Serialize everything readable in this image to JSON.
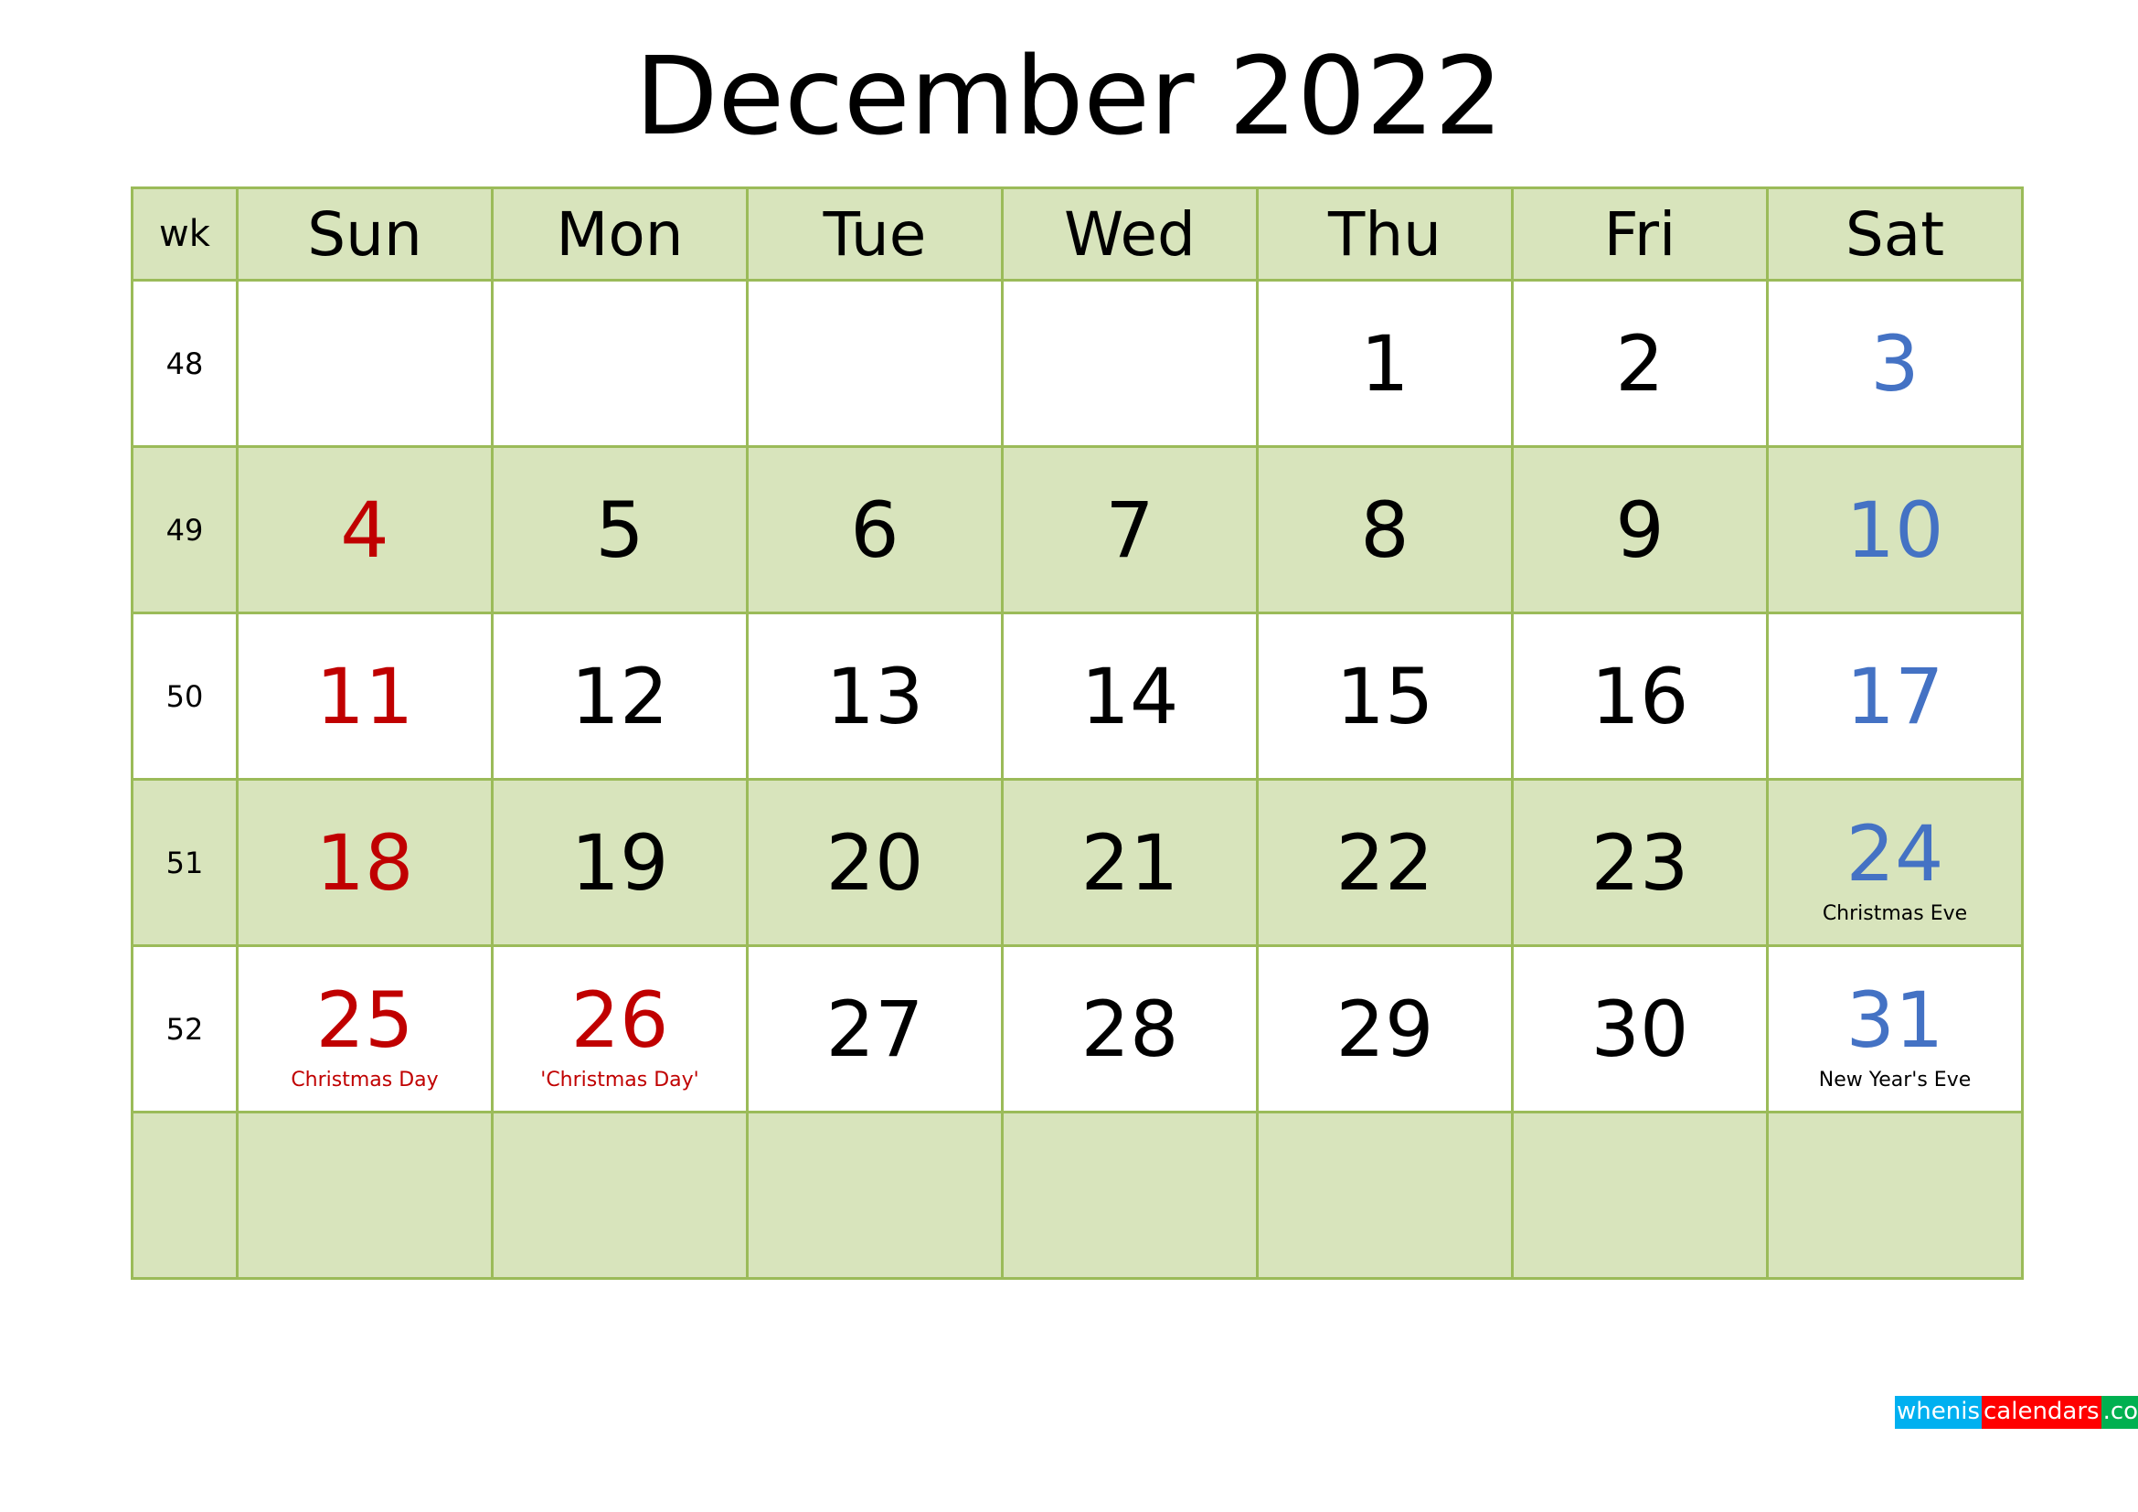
{
  "title": "December 2022",
  "header": {
    "wk": "wk",
    "days": [
      "Sun",
      "Mon",
      "Tue",
      "Wed",
      "Thu",
      "Fri",
      "Sat"
    ]
  },
  "colors": {
    "grid": "#9bbb59",
    "shade": "#d8e4bc",
    "sunday_holiday": "#c00000",
    "saturday": "#4472c4"
  },
  "weeks": [
    {
      "wk": "48",
      "cells": [
        {
          "d": ""
        },
        {
          "d": ""
        },
        {
          "d": ""
        },
        {
          "d": ""
        },
        {
          "d": "1"
        },
        {
          "d": "2"
        },
        {
          "d": "3"
        }
      ]
    },
    {
      "wk": "49",
      "cells": [
        {
          "d": "4"
        },
        {
          "d": "5"
        },
        {
          "d": "6"
        },
        {
          "d": "7"
        },
        {
          "d": "8"
        },
        {
          "d": "9"
        },
        {
          "d": "10"
        }
      ]
    },
    {
      "wk": "50",
      "cells": [
        {
          "d": "11"
        },
        {
          "d": "12"
        },
        {
          "d": "13"
        },
        {
          "d": "14"
        },
        {
          "d": "15"
        },
        {
          "d": "16"
        },
        {
          "d": "17"
        }
      ]
    },
    {
      "wk": "51",
      "cells": [
        {
          "d": "18"
        },
        {
          "d": "19"
        },
        {
          "d": "20"
        },
        {
          "d": "21"
        },
        {
          "d": "22"
        },
        {
          "d": "23"
        },
        {
          "d": "24",
          "note": "Christmas Eve"
        }
      ]
    },
    {
      "wk": "52",
      "cells": [
        {
          "d": "25",
          "note": "Christmas Day",
          "red": true
        },
        {
          "d": "26",
          "note": "'Christmas Day'",
          "red": true
        },
        {
          "d": "27"
        },
        {
          "d": "28"
        },
        {
          "d": "29"
        },
        {
          "d": "30"
        },
        {
          "d": "31",
          "note": "New Year's Eve"
        }
      ]
    },
    {
      "wk": "",
      "cells": [
        {
          "d": ""
        },
        {
          "d": ""
        },
        {
          "d": ""
        },
        {
          "d": ""
        },
        {
          "d": ""
        },
        {
          "d": ""
        },
        {
          "d": ""
        }
      ]
    }
  ],
  "logo": {
    "part1": "whenis",
    "part2": "calendars",
    "part3": ".com",
    "colors": [
      "#00b0f0",
      "#ff0000",
      "#00b050"
    ]
  }
}
